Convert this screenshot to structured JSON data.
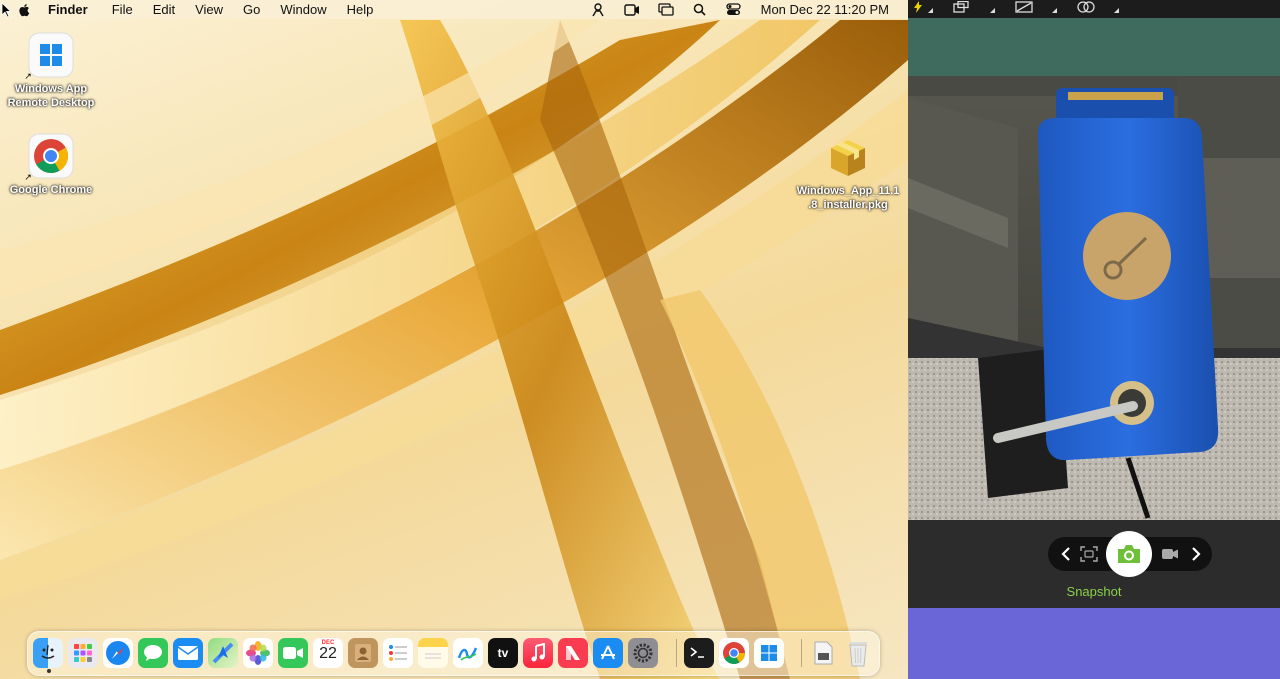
{
  "menubar": {
    "app_name": "Finder",
    "menus": [
      "File",
      "Edit",
      "View",
      "Go",
      "Window",
      "Help"
    ],
    "clock": "Mon Dec 22  11:20 PM"
  },
  "desktop": {
    "icons": [
      {
        "label": "Windows App Remote Desktop",
        "line1": "Windows App",
        "line2": "Remote Desktop"
      },
      {
        "label": "Google Chrome",
        "line1": "Google Chrome",
        "line2": ""
      },
      {
        "label": "Windows_App_11.1.8_installer.pkg",
        "line1": "Windows_App_11.1",
        "line2": ".8_installer.pkg"
      }
    ]
  },
  "dock": {
    "apps": [
      "Finder",
      "Launchpad",
      "Safari",
      "Messages",
      "Mail",
      "Maps",
      "Photos",
      "FaceTime",
      "Calendar",
      "Contacts",
      "Reminders",
      "Notes",
      "Freeform",
      "TV",
      "Music",
      "News",
      "App Store",
      "System Settings",
      "Terminal",
      "Google Chrome",
      "Windows App",
      "Downloads",
      "Trash"
    ],
    "calendar_month": "DEC",
    "calendar_day": "22",
    "tv_label": "tv"
  },
  "camera": {
    "snapshot_label": "Snapshot"
  },
  "colors": {
    "panel_bg": "#2e2e2e",
    "accent_green": "#8bd04a",
    "purple_bar": "#6a66d8",
    "key_blue": "#1f5fc8"
  }
}
